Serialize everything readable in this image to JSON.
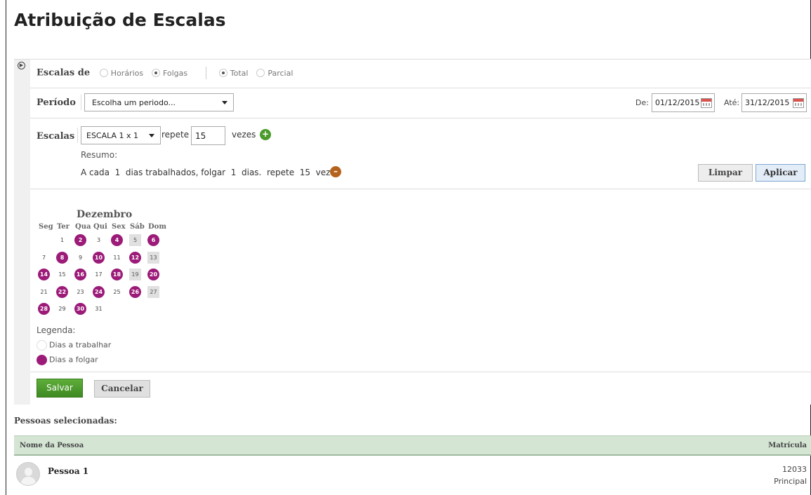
{
  "page": {
    "title": "Atribuição de Escalas"
  },
  "filters": {
    "escalas_de_label": "Escalas de",
    "options_type": [
      "Horários",
      "Folgas"
    ],
    "options_scope": [
      "Total",
      "Parcial"
    ],
    "selected_type": "Folgas",
    "selected_scope": "Total"
  },
  "periodo": {
    "label": "Período",
    "select_value": "Escolha um periodo...",
    "de_label": "De:",
    "de_value": "01/12/2015",
    "ate_label": "Até:",
    "ate_value": "31/12/2015"
  },
  "escalas": {
    "label": "Escalas",
    "select_value": "ESCALA 1 x 1",
    "repete_label": "repete",
    "repete_value": "15",
    "vezes_label": "vezes",
    "add_symbol": "+",
    "resumo_label": "Resumo:",
    "resumo_text": "A cada  1  dias trabalhados, folgar  1  dias.  repete  15  vezes",
    "remove_symbol": "–"
  },
  "buttons": {
    "limpar": "Limpar",
    "aplicar": "Aplicar",
    "salvar": "Salvar",
    "cancelar": "Cancelar"
  },
  "calendar": {
    "month": "Dezembro",
    "weekdays": [
      "Seg",
      "Ter",
      "Qua",
      "Qui",
      "Sex",
      "Sáb",
      "Dom"
    ],
    "start_weekday_index": 1,
    "days_in_month": 31,
    "off_days": [
      2,
      4,
      6,
      8,
      10,
      12,
      14,
      16,
      18,
      20,
      22,
      24,
      26,
      28,
      30
    ],
    "weekend_shaded": [
      5,
      13,
      19,
      27
    ]
  },
  "legend": {
    "title": "Legenda:",
    "work": "Dias a trabalhar",
    "off": "Dias a folgar",
    "off_color": "#9c1a78"
  },
  "people": {
    "section_title": "Pessoas selecionadas:",
    "col_name": "Nome da Pessoa",
    "col_matricula": "Matrícula",
    "rows": [
      {
        "name": "Pessoa 1",
        "matricula": "12033",
        "tipo": "Principal"
      }
    ]
  },
  "colors": {
    "accent_green": "#4a9a2c",
    "off_purple": "#9c1a78",
    "remove_brown": "#b5631c",
    "header_green": "#d4e5d4"
  }
}
